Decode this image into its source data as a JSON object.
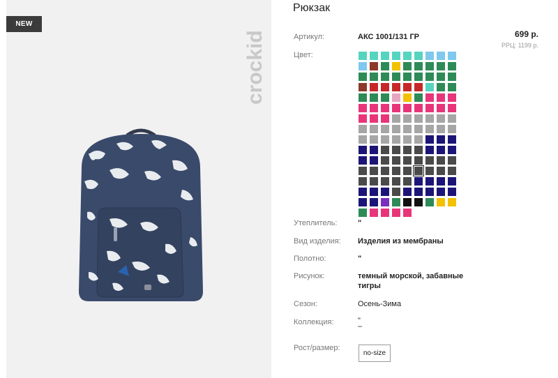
{
  "badge": "NEW",
  "brand": "crockid",
  "product": {
    "title": "Рюкзак",
    "price": "699 р.",
    "rrp": "РРЦ: 1199 р."
  },
  "attributes": [
    {
      "label": "Артикул:",
      "value": "АКС 1001/131 ГР"
    },
    {
      "label": "Цвет:",
      "value": ""
    },
    {
      "label": "Утеплитель:",
      "value": "\""
    },
    {
      "label": "Вид изделия:",
      "value": "Изделия из мембраны"
    },
    {
      "label": "Полотно:",
      "value": "\""
    },
    {
      "label": "Рисунок:",
      "value_line1": "темный морской, забавные",
      "value_line2": "тигры"
    },
    {
      "label": "Сезон:",
      "value": "Осень-Зима"
    },
    {
      "label": "Коллекция:",
      "value_line1": "\"",
      "value_line2": "–"
    },
    {
      "label": "Рост/размер:",
      "value": ""
    }
  ],
  "size_option": "no-size",
  "swatch_colors": [
    "#55d4c0",
    "#55d4c0",
    "#55d4c0",
    "#55d4c0",
    "#55d4c0",
    "#55d4c0",
    "#7fc8ee",
    "#7fc8ee",
    "#7fc8ee",
    "#7fc8ee",
    "#8b3a2a",
    "#2e8b57",
    "#f2c200",
    "#2e8b57",
    "#2e8b57",
    "#2e8b57",
    "#2e8b57",
    "#2e8b57",
    "#2e8b57",
    "#2e8b57",
    "#2e8b57",
    "#2e8b57",
    "#2e8b57",
    "#2e8b57",
    "#2e8b57",
    "#2e8b57",
    "#2e8b57",
    "#8b3a2a",
    "#c62828",
    "#c62828",
    "#c62828",
    "#c62828",
    "#c62828",
    "#55d4c0",
    "#2e8b57",
    "#2e8b57",
    "#2e8b57",
    "#2e8b57",
    "#2e8b57",
    "#e8a5c0",
    "#f2c200",
    "#2e8b57",
    "#e8357a",
    "#e8357a",
    "#e8357a",
    "#e8357a",
    "#e8357a",
    "#e8357a",
    "#e8357a",
    "#e8357a",
    "#e8357a",
    "#e8357a",
    "#e8357a",
    "#e8357a",
    "#e8357a",
    "#e8357a",
    "#e8357a",
    "#a6a6a6",
    "#a6a6a6",
    "#a6a6a6",
    "#a6a6a6",
    "#a6a6a6",
    "#a6a6a6",
    "#a6a6a6",
    "#a6a6a6",
    "#a6a6a6",
    "#a6a6a6",
    "#a6a6a6",
    "#a6a6a6",
    "#a6a6a6",
    "#a6a6a6",
    "#a6a6a6",
    "#a6a6a6",
    "#a6a6a6",
    "#a6a6a6",
    "#a6a6a6",
    "#a6a6a6",
    "#a6a6a6",
    "#1c1577",
    "#1c1577",
    "#1c1577",
    "#1c1577",
    "#1c1577",
    "#4a4a4a",
    "#4a4a4a",
    "#4a4a4a",
    "#4a4a4a",
    "#1c1577",
    "#1c1577",
    "#1c1577",
    "#1c1577",
    "#1c1577",
    "#4a4a4a",
    "#4a4a4a",
    "#4a4a4a",
    "#4a4a4a",
    "#4a4a4a",
    "#4a4a4a",
    "#4a4a4a",
    "#4a4a4a",
    "#4a4a4a",
    "#4a4a4a",
    "#4a4a4a",
    "#4a4a4a",
    "#4a4a4a",
    "#4a4a4a",
    "#4a4a4a",
    "#4a4a4a",
    "#4a4a4a",
    "#4a4a4a",
    "#4a4a4a",
    "#4a4a4a",
    "#4a4a4a",
    "#1c1577",
    "#1c1577",
    "#1c1577",
    "#1c1577",
    "#1c1577",
    "#1c1577",
    "#1c1577",
    "#4a4a4a",
    "#1c1577",
    "#1c1577",
    "#1c1577",
    "#1c1577",
    "#1c1577",
    "#1c1577",
    "#1c1577",
    "#7b2fbf",
    "#2e8b57",
    "#111111",
    "#111111",
    "#2e8b57",
    "#f2c200",
    "#f2c200",
    "#2e8b57",
    "#e8357a",
    "#e8357a",
    "#e8357a",
    "#e8357a"
  ],
  "selected_swatch_index": 104,
  "colors": {
    "badge_bg": "#3b3b3b",
    "panel_bg": "#f1f1f1",
    "backpack_navy": "#3a4a6b"
  }
}
